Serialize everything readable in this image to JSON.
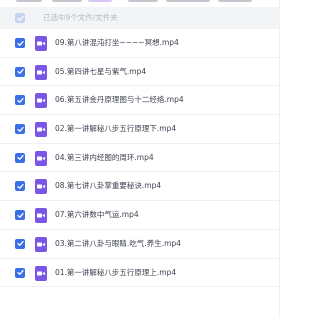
{
  "header": {
    "select_all_label": "已选中9个文件/文件夹"
  },
  "files": [
    {
      "name": "09.第八讲混沌打坐~~~~冥想.mp4",
      "checked": true,
      "icon": "video-file-icon"
    },
    {
      "name": "05.第四讲七星与紫气.mp4",
      "checked": true,
      "icon": "video-file-icon"
    },
    {
      "name": "06.第五讲金丹原理图与十二经络.mp4",
      "checked": true,
      "icon": "video-file-icon"
    },
    {
      "name": "02.第一讲解秘八步五行原理下.mp4",
      "checked": true,
      "icon": "video-file-icon"
    },
    {
      "name": "04.第三讲内经图的周环.mp4",
      "checked": true,
      "icon": "video-file-icon"
    },
    {
      "name": "08.第七讲八卦掌重要秘诀.mp4",
      "checked": true,
      "icon": "video-file-icon"
    },
    {
      "name": "07.第六讲数中气运.mp4",
      "checked": true,
      "icon": "video-file-icon"
    },
    {
      "name": "03.第二讲八卦与眼睛.吃气.养生.mp4",
      "checked": true,
      "icon": "video-file-icon"
    },
    {
      "name": "01.第一讲解秘八步五行原理上.mp4",
      "checked": true,
      "icon": "video-file-icon"
    }
  ],
  "colors": {
    "checkbox_checked": "#3a6fe5",
    "checkbox_partial": "#c6d3f2",
    "video_icon": "#7a55e6",
    "header_bg": "#f3f4f6"
  }
}
